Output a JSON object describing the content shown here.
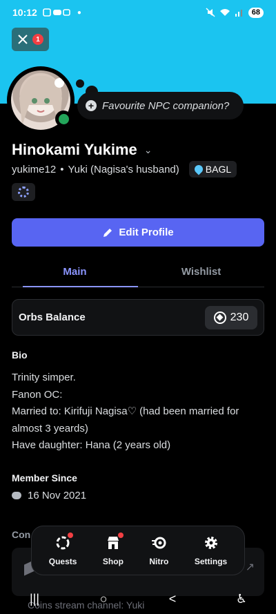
{
  "status_bar": {
    "time": "10:12",
    "battery": "68"
  },
  "header": {
    "notification_count": "1"
  },
  "profile": {
    "custom_status": "Favourite NPC companion?",
    "display_name": "Hinokami Yukime",
    "username": "yukime12",
    "separator": "•",
    "pronouns": "Yuki (Nagisa's husband)",
    "guild_tag": "BAGL",
    "edit_button": "Edit Profile",
    "avatar_status": "online",
    "accent_color": "#1bc4f0",
    "button_color": "#5865f2"
  },
  "tabs": [
    {
      "label": "Main",
      "active": true
    },
    {
      "label": "Wishlist",
      "active": false
    }
  ],
  "orbs": {
    "label": "Orbs Balance",
    "value": "230"
  },
  "bio": {
    "title": "Bio",
    "lines": [
      "Trinity simper.",
      "Fanon OC:",
      "Married to: Kirifuji Nagisa♡ (had been married for almost 3 yeards)",
      "Have daughter: Hana (2 years old)"
    ]
  },
  "member_since": {
    "title": "Member Since",
    "date": "16 Nov 2021"
  },
  "connections": {
    "title": "Con",
    "partial_text": "Coins stream channel: Yuki"
  },
  "dock": [
    {
      "label": "Quests",
      "icon": "quests-icon",
      "has_dot": true
    },
    {
      "label": "Shop",
      "icon": "shop-icon",
      "has_dot": true
    },
    {
      "label": "Nitro",
      "icon": "nitro-icon",
      "has_dot": false
    },
    {
      "label": "Settings",
      "icon": "gear-icon",
      "has_dot": false
    }
  ],
  "system_nav": {
    "recents": "|||",
    "home": "○",
    "back": "<",
    "accessibility": "♿"
  }
}
